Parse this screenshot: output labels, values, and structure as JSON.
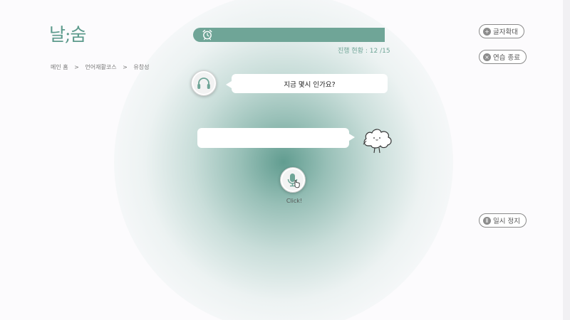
{
  "app": {
    "logo": "날;숨"
  },
  "breadcrumb": {
    "home": "메인 홈",
    "sep1": ">",
    "course": "언어재활코스",
    "sep2": ">",
    "current": "유창성"
  },
  "progress": {
    "label": "진행 현황 :",
    "count": "12 /15",
    "fraction": 1.0
  },
  "toolbar": {
    "zoom_label": "글자확대",
    "end_label": "연습 종료",
    "pause_label": "일시 정지"
  },
  "question": {
    "text": "지금 몇시 인가요?"
  },
  "answer": {
    "text": ""
  },
  "mic": {
    "label": "Click!"
  },
  "colors": {
    "accent": "#6fa597",
    "text_gray": "#555555",
    "button_border": "#8a8a8a"
  },
  "icons": [
    "alarm-clock-icon",
    "plus-circle-icon",
    "close-circle-icon",
    "pause-circle-icon",
    "headphones-icon",
    "cloud-character-icon",
    "microphone-icon",
    "hand-pointer-icon"
  ]
}
